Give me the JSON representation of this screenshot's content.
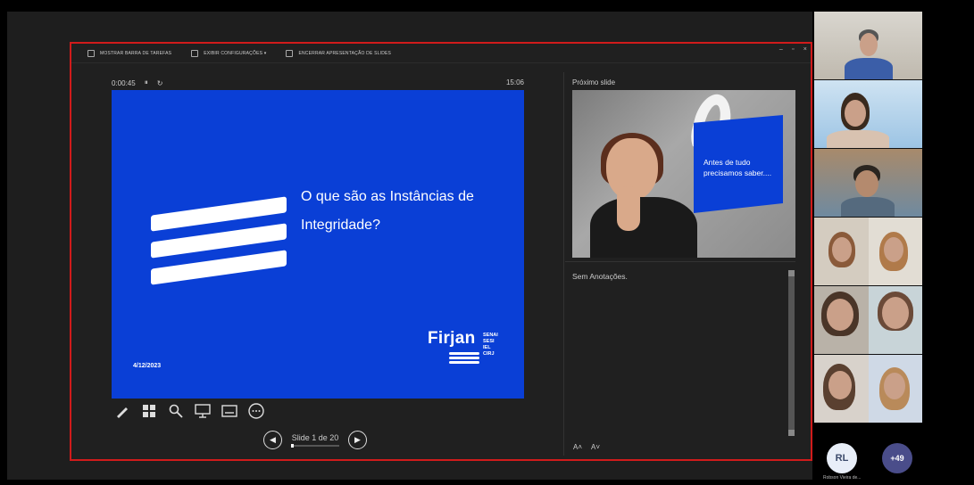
{
  "toolbar": {
    "taskbar_label": "MOSTRAR BARRA DE TAREFAS",
    "settings_label": "EXIBIR CONFIGURAÇÕES ▾",
    "end_label": "ENCERRAR APRESENTAÇÃO DE SLIDES",
    "window_controls": [
      "–",
      "▫",
      "×"
    ]
  },
  "timer": {
    "elapsed": "0:00:45",
    "pause": "⏸",
    "reset": "↻",
    "clock": "15:06"
  },
  "current_slide": {
    "title": "O que são as Instâncias de Integridade?",
    "date": "4/12/2023",
    "logo_word": "Firjan",
    "logo_sub": [
      "SENAI",
      "SESI",
      "IEL",
      "CIRJ"
    ],
    "bg_color": "#0a3fd6"
  },
  "tools": [
    "pen-icon",
    "grid-icon",
    "zoom-icon",
    "pointer-icon",
    "subtitle-icon",
    "more-icon"
  ],
  "navigation": {
    "prev": "◀",
    "label": "Slide 1 de 20",
    "next": "▶"
  },
  "next_slide": {
    "label": "Próximo slide",
    "text": "Antes de tudo precisamos saber...."
  },
  "notes": {
    "text": "Sem Anotações."
  },
  "font_controls": [
    "A˄",
    "A˅"
  ],
  "participants": {
    "avatar_initials": "RL",
    "avatar_name": "Robson Vieira de...",
    "more_count": "+49"
  }
}
